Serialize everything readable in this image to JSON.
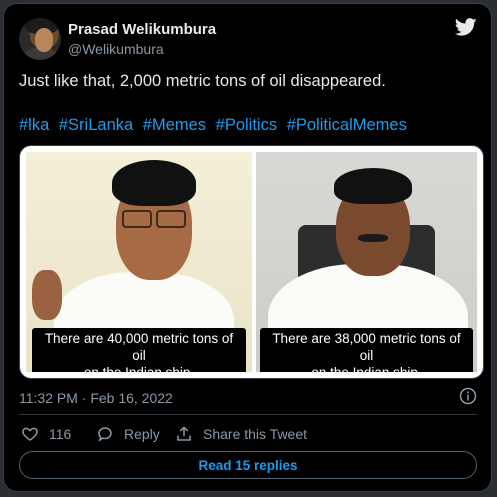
{
  "author": {
    "name": "Prasad Welikumbura",
    "handle": "@Welikumbura"
  },
  "icons": {
    "brand": "twitter-bird-icon",
    "info": "info-icon",
    "like": "heart-icon",
    "reply": "speech-bubble-icon",
    "share": "share-icon"
  },
  "colors": {
    "accent": "#1d9bf0",
    "background": "#000000",
    "muted": "#8b98a5"
  },
  "tweet": {
    "text": "Just like that, 2,000 metric tons of oil disappeared.",
    "hashtags": [
      "#lka",
      "#SriLanka",
      "#Memes",
      "#Politics",
      "#PoliticalMemes"
    ]
  },
  "media": {
    "left_caption_line1": "There are 40,000 metric tons of oil",
    "left_caption_line2": "on the Indian ship.",
    "right_caption_line1": "There are 38,000 metric tons of oil",
    "right_caption_line2": "on the Indian ship."
  },
  "meta": {
    "timestamp": "11:32 PM · Feb 16, 2022"
  },
  "actions": {
    "like_count": "116",
    "reply_label": "Reply",
    "share_label": "Share this Tweet"
  },
  "replies_button": {
    "label": "Read 15 replies"
  }
}
